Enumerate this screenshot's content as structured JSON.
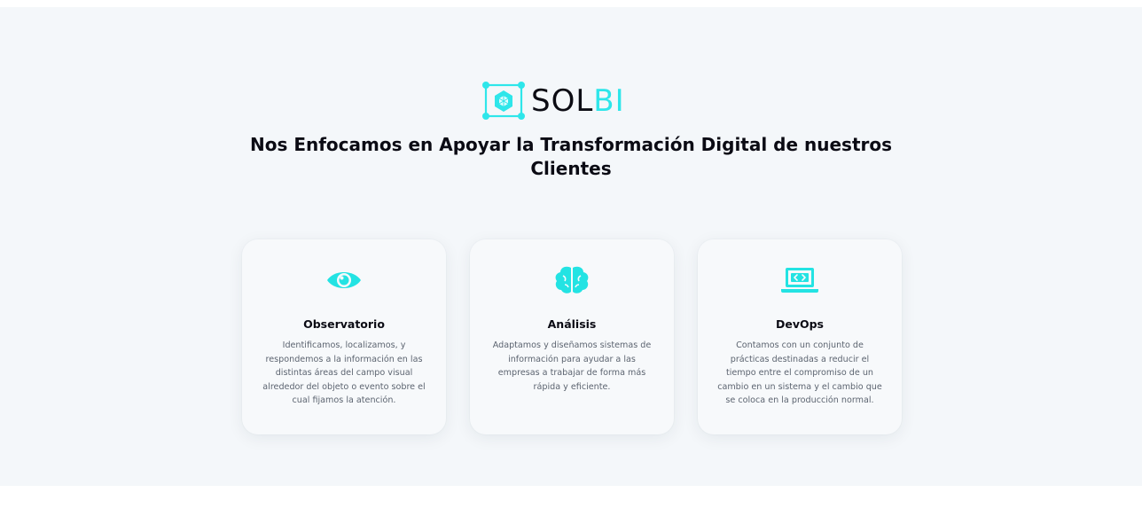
{
  "brand": {
    "logo_text_dark": "SOL",
    "logo_text_light": "BI",
    "logo_icon": "cube-network-icon",
    "accent_color": "#2ee6ea"
  },
  "hero": {
    "headline": "Nos Enfocamos en Apoyar la Transformación Digital de nuestros Clientes"
  },
  "cards": [
    {
      "icon": "eye-icon",
      "title": "Observatorio",
      "description": "Identificamos, localizamos, y respondemos a la información en las distintas áreas del campo visual alrededor del objeto o evento sobre el cual fijamos la atención."
    },
    {
      "icon": "brain-icon",
      "title": "Análisis",
      "description": "Adaptamos y diseñamos sistemas de información para ayudar a las empresas a trabajar de forma más rápida y eficiente."
    },
    {
      "icon": "laptop-code-icon",
      "title": "DevOps",
      "description": "Contamos con un conjunto de prácticas destinadas a reducir el tiempo entre el compromiso de un cambio en un sistema y el cambio que se coloca en la producción normal."
    }
  ]
}
